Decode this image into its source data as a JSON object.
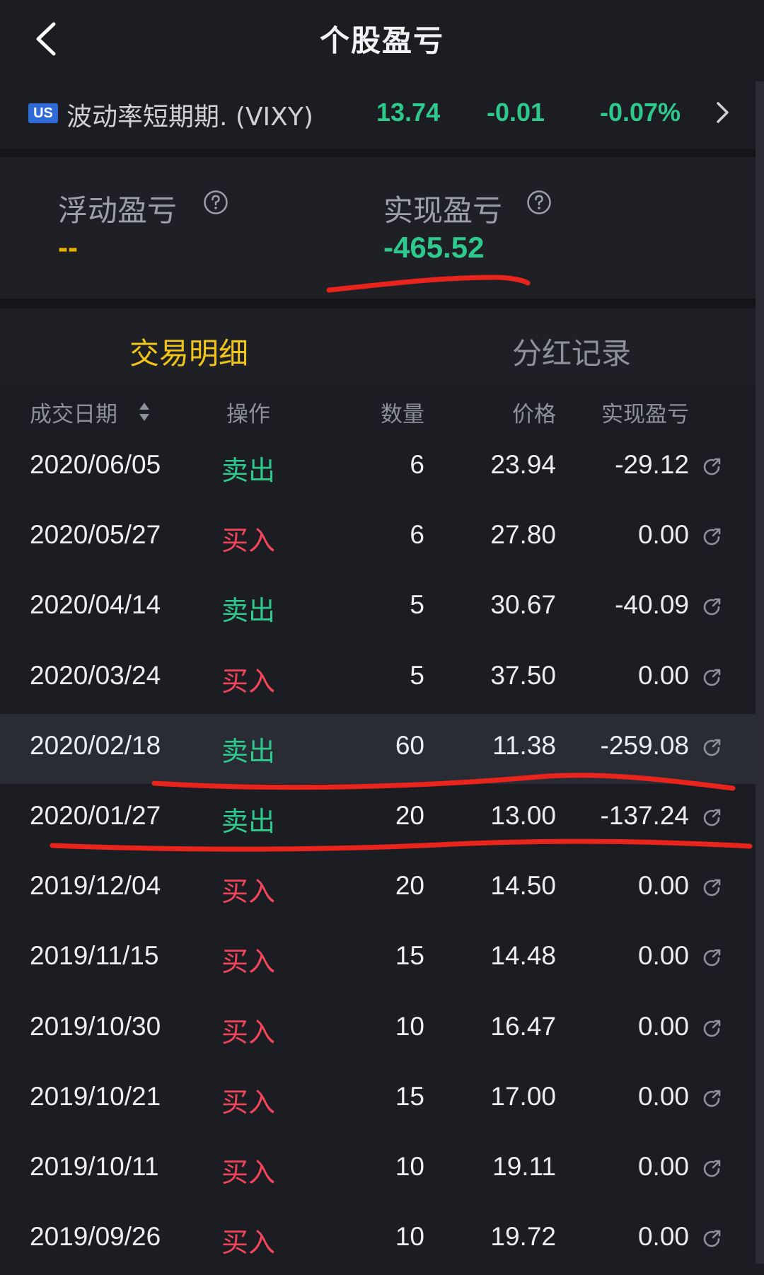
{
  "header": {
    "title": "个股盈亏"
  },
  "quote": {
    "market": "US",
    "name": "波动率短期期. (VIXY)",
    "price": "13.74",
    "change": "-0.01",
    "change_pct": "-0.07%"
  },
  "pnl": {
    "floating_label": "浮动盈亏",
    "floating_value": "--",
    "realized_label": "实现盈亏",
    "realized_value": "-465.52"
  },
  "tabs": {
    "active": "交易明细",
    "inactive": "分红记录"
  },
  "table": {
    "headers": {
      "date": "成交日期",
      "op": "操作",
      "qty": "数量",
      "price": "价格",
      "pnl": "实现盈亏"
    },
    "rows": [
      {
        "date": "2020/06/05",
        "op": "卖出",
        "qty": "6",
        "price": "23.94",
        "pnl": "-29.12"
      },
      {
        "date": "2020/05/27",
        "op": "买入",
        "qty": "6",
        "price": "27.80",
        "pnl": "0.00"
      },
      {
        "date": "2020/04/14",
        "op": "卖出",
        "qty": "5",
        "price": "30.67",
        "pnl": "-40.09"
      },
      {
        "date": "2020/03/24",
        "op": "买入",
        "qty": "5",
        "price": "37.50",
        "pnl": "0.00"
      },
      {
        "date": "2020/02/18",
        "op": "卖出",
        "qty": "60",
        "price": "11.38",
        "pnl": "-259.08"
      },
      {
        "date": "2020/01/27",
        "op": "卖出",
        "qty": "20",
        "price": "13.00",
        "pnl": "-137.24"
      },
      {
        "date": "2019/12/04",
        "op": "买入",
        "qty": "20",
        "price": "14.50",
        "pnl": "0.00"
      },
      {
        "date": "2019/11/15",
        "op": "买入",
        "qty": "15",
        "price": "14.48",
        "pnl": "0.00"
      },
      {
        "date": "2019/10/30",
        "op": "买入",
        "qty": "10",
        "price": "16.47",
        "pnl": "0.00"
      },
      {
        "date": "2019/10/21",
        "op": "买入",
        "qty": "15",
        "price": "17.00",
        "pnl": "0.00"
      },
      {
        "date": "2019/10/11",
        "op": "买入",
        "qty": "10",
        "price": "19.11",
        "pnl": "0.00"
      },
      {
        "date": "2019/09/26",
        "op": "买入",
        "qty": "10",
        "price": "19.72",
        "pnl": "0.00"
      }
    ]
  },
  "colors": {
    "sell": "#2ec98d",
    "buy": "#f0455a",
    "accent": "#f0c419",
    "annotation": "#e8241c"
  }
}
